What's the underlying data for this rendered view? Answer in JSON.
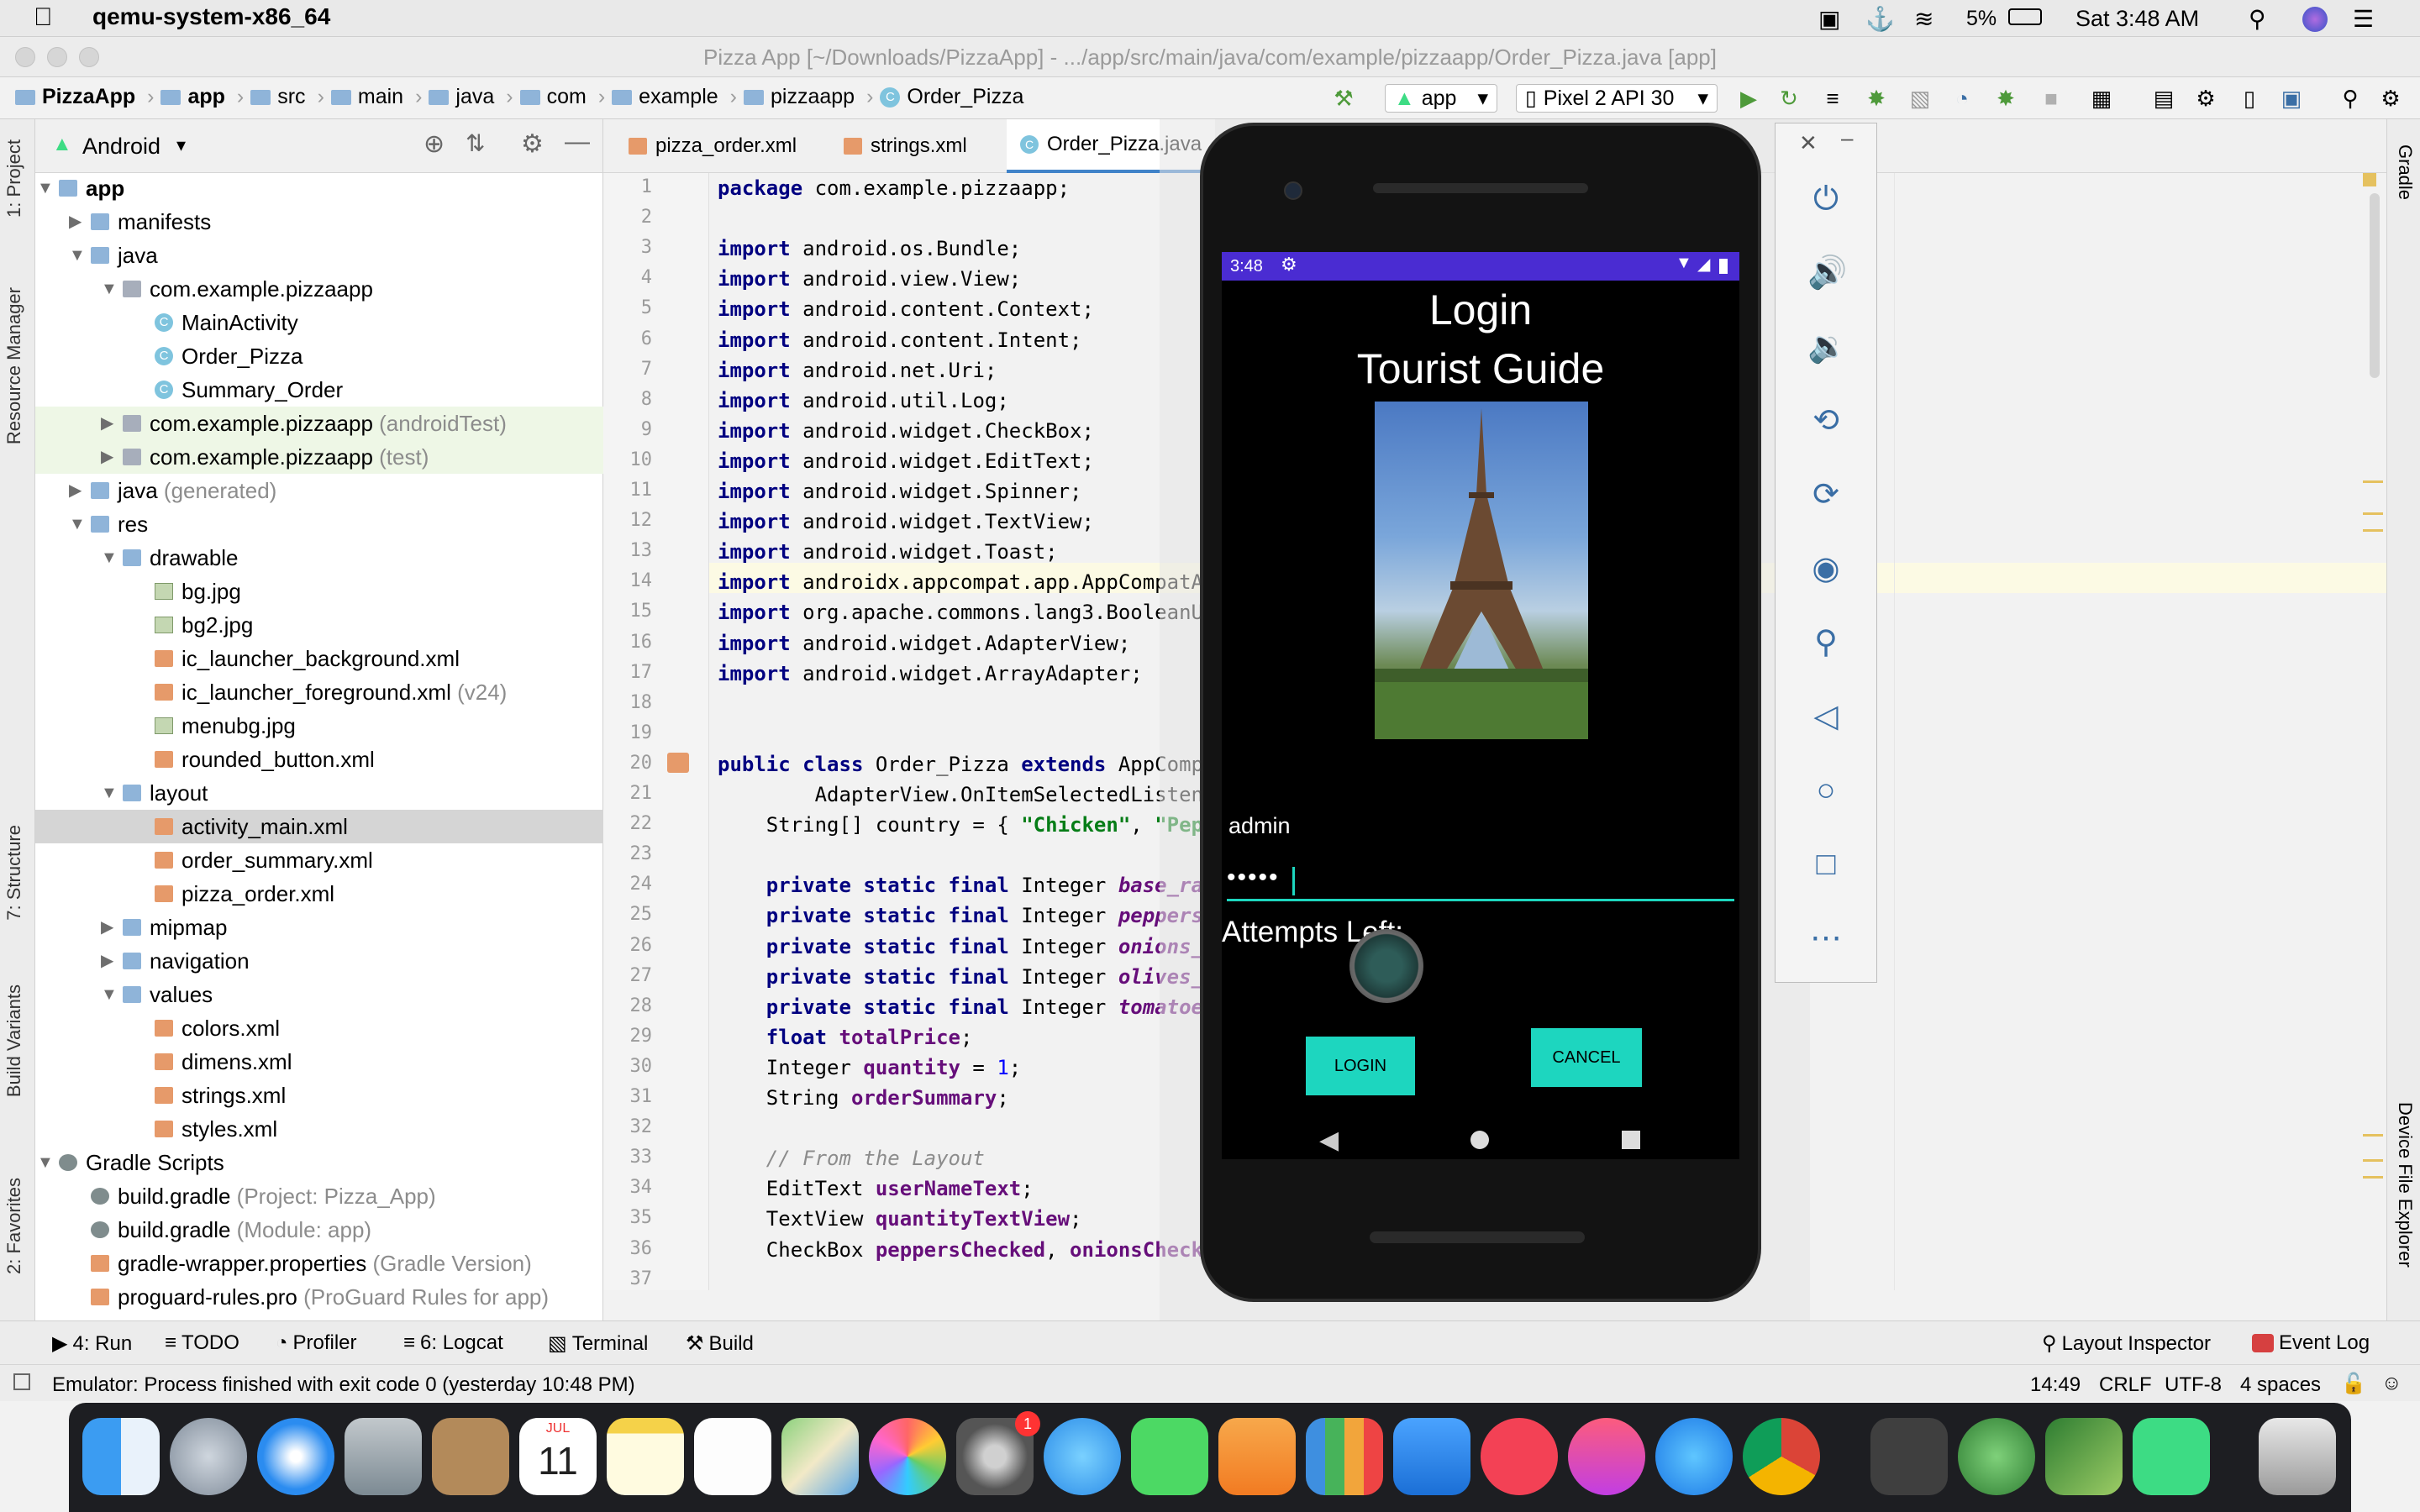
{
  "menubar": {
    "app_name": "qemu-system-x86_64",
    "battery": "5%",
    "clock": "Sat 3:48 AM"
  },
  "window": {
    "title": "Pizza App [~/Downloads/PizzaApp] - .../app/src/main/java/com/example/pizzaapp/Order_Pizza.java [app]"
  },
  "breadcrumb": [
    "PizzaApp",
    "app",
    "src",
    "main",
    "java",
    "com",
    "example",
    "pizzaapp",
    "Order_Pizza"
  ],
  "toolbar": {
    "run_config": "app",
    "device": "Pixel 2 API 30"
  },
  "left_stripe": {
    "project": "1: Project",
    "resource_manager": "Resource Manager",
    "structure": "7: Structure",
    "build_variants": "Build Variants",
    "favorites": "2: Favorites"
  },
  "right_stripe": {
    "gradle": "Gradle",
    "device_file_explorer": "Device File Explorer"
  },
  "project_panel": {
    "view": "Android",
    "tree": [
      {
        "label": "app",
        "suffix": "",
        "indent": 0,
        "type": "folder",
        "bold": true,
        "expanded": true
      },
      {
        "label": "manifests",
        "suffix": "",
        "indent": 1,
        "type": "folder",
        "expanded": false
      },
      {
        "label": "java",
        "suffix": "",
        "indent": 1,
        "type": "folder",
        "expanded": true
      },
      {
        "label": "com.example.pizzaapp",
        "suffix": "",
        "indent": 2,
        "type": "pkg",
        "expanded": true
      },
      {
        "label": "MainActivity",
        "suffix": "",
        "indent": 3,
        "type": "cls"
      },
      {
        "label": "Order_Pizza",
        "suffix": "",
        "indent": 3,
        "type": "cls"
      },
      {
        "label": "Summary_Order",
        "suffix": "",
        "indent": 3,
        "type": "cls"
      },
      {
        "label": "com.example.pizzaapp",
        "suffix": "(androidTest)",
        "indent": 2,
        "type": "pkg",
        "expanded": false,
        "tint": true
      },
      {
        "label": "com.example.pizzaapp",
        "suffix": "(test)",
        "indent": 2,
        "type": "pkg",
        "expanded": false,
        "tint": true
      },
      {
        "label": "java",
        "suffix": "(generated)",
        "indent": 1,
        "type": "folder",
        "expanded": false
      },
      {
        "label": "res",
        "suffix": "",
        "indent": 1,
        "type": "folder",
        "expanded": true
      },
      {
        "label": "drawable",
        "suffix": "",
        "indent": 2,
        "type": "folder",
        "expanded": true
      },
      {
        "label": "bg.jpg",
        "suffix": "",
        "indent": 3,
        "type": "img"
      },
      {
        "label": "bg2.jpg",
        "suffix": "",
        "indent": 3,
        "type": "img"
      },
      {
        "label": "ic_launcher_background.xml",
        "suffix": "",
        "indent": 3,
        "type": "xml"
      },
      {
        "label": "ic_launcher_foreground.xml",
        "suffix": "(v24)",
        "indent": 3,
        "type": "xml"
      },
      {
        "label": "menubg.jpg",
        "suffix": "",
        "indent": 3,
        "type": "img"
      },
      {
        "label": "rounded_button.xml",
        "suffix": "",
        "indent": 3,
        "type": "xml"
      },
      {
        "label": "layout",
        "suffix": "",
        "indent": 2,
        "type": "folder",
        "expanded": true
      },
      {
        "label": "activity_main.xml",
        "suffix": "",
        "indent": 3,
        "type": "xml",
        "selected": true
      },
      {
        "label": "order_summary.xml",
        "suffix": "",
        "indent": 3,
        "type": "xml"
      },
      {
        "label": "pizza_order.xml",
        "suffix": "",
        "indent": 3,
        "type": "xml"
      },
      {
        "label": "mipmap",
        "suffix": "",
        "indent": 2,
        "type": "folder",
        "expanded": false
      },
      {
        "label": "navigation",
        "suffix": "",
        "indent": 2,
        "type": "folder",
        "expanded": false
      },
      {
        "label": "values",
        "suffix": "",
        "indent": 2,
        "type": "folder",
        "expanded": true
      },
      {
        "label": "colors.xml",
        "suffix": "",
        "indent": 3,
        "type": "xml"
      },
      {
        "label": "dimens.xml",
        "suffix": "",
        "indent": 3,
        "type": "xml"
      },
      {
        "label": "strings.xml",
        "suffix": "",
        "indent": 3,
        "type": "xml"
      },
      {
        "label": "styles.xml",
        "suffix": "",
        "indent": 3,
        "type": "xml"
      },
      {
        "label": "Gradle Scripts",
        "suffix": "",
        "indent": 0,
        "type": "grd",
        "expanded": true
      },
      {
        "label": "build.gradle",
        "suffix": "(Project: Pizza_App)",
        "indent": 1,
        "type": "grd"
      },
      {
        "label": "build.gradle",
        "suffix": "(Module: app)",
        "indent": 1,
        "type": "grd"
      },
      {
        "label": "gradle-wrapper.properties",
        "suffix": "(Gradle Version)",
        "indent": 1,
        "type": "xml"
      },
      {
        "label": "proguard-rules.pro",
        "suffix": "(ProGuard Rules for app)",
        "indent": 1,
        "type": "xml"
      }
    ]
  },
  "editor_tabs": [
    {
      "label": "pizza_order.xml",
      "active": false
    },
    {
      "label": "strings.xml",
      "active": false
    },
    {
      "label": "Order_Pizza.java",
      "active": true
    }
  ],
  "code_lines": [
    [
      [
        "kw",
        "package"
      ],
      [
        "",
        "com.example.pizzaapp;"
      ]
    ],
    [],
    [
      [
        "kw",
        "import"
      ],
      [
        "",
        "android.os.Bundle;"
      ]
    ],
    [
      [
        "kw",
        "import"
      ],
      [
        "",
        "android.view.View;"
      ]
    ],
    [
      [
        "kw",
        "import"
      ],
      [
        "",
        "android.content.Context;"
      ]
    ],
    [
      [
        "kw",
        "import"
      ],
      [
        "",
        "android.content.Intent;"
      ]
    ],
    [
      [
        "kw",
        "import"
      ],
      [
        "",
        "android.net.Uri;"
      ]
    ],
    [
      [
        "kw",
        "import"
      ],
      [
        "",
        "android.util.Log;"
      ]
    ],
    [
      [
        "kw",
        "import"
      ],
      [
        "",
        "android.widget.CheckBox;"
      ]
    ],
    [
      [
        "kw",
        "import"
      ],
      [
        "",
        "android.widget.EditText;"
      ]
    ],
    [
      [
        "kw",
        "import"
      ],
      [
        "",
        "android.widget.Spinner;"
      ]
    ],
    [
      [
        "kw",
        "import"
      ],
      [
        "",
        "android.widget.TextView;"
      ]
    ],
    [
      [
        "kw",
        "import"
      ],
      [
        "",
        "android.widget.Toast;"
      ]
    ],
    [
      [
        "kw",
        "import"
      ],
      [
        "",
        "androidx.appcompat.app.AppCompatAc"
      ]
    ],
    [
      [
        "kw",
        "import"
      ],
      [
        "",
        "org.apache.commons.lang3.BooleanUt"
      ]
    ],
    [
      [
        "kw",
        "import"
      ],
      [
        "",
        "android.widget.AdapterView;"
      ]
    ],
    [
      [
        "kw",
        "import"
      ],
      [
        "",
        "android.widget.ArrayAdapter;"
      ]
    ],
    [],
    [],
    [
      [
        "kw",
        "public class"
      ],
      [
        "",
        "Order_Pizza"
      ],
      [
        "kw",
        "extends"
      ],
      [
        "",
        "AppCompa"
      ]
    ],
    [
      [
        "",
        "        AdapterView.OnItemSelectedListene"
      ]
    ],
    [
      [
        "",
        "    String[] country = { "
      ],
      [
        "st",
        "\"Chicken\""
      ],
      [
        "",
        ", "
      ],
      [
        "st",
        "\"Pepp"
      ]
    ],
    [],
    [
      [
        "",
        "    "
      ],
      [
        "kw",
        "private static final"
      ],
      [
        "",
        "Integer"
      ],
      [
        "it",
        "base_rat"
      ]
    ],
    [
      [
        "",
        "    "
      ],
      [
        "kw",
        "private static final"
      ],
      [
        "",
        "Integer"
      ],
      [
        "it",
        "peppers_"
      ]
    ],
    [
      [
        "",
        "    "
      ],
      [
        "kw",
        "private static final"
      ],
      [
        "",
        "Integer"
      ],
      [
        "it",
        "onions_r"
      ]
    ],
    [
      [
        "",
        "    "
      ],
      [
        "kw",
        "private static final"
      ],
      [
        "",
        "Integer"
      ],
      [
        "it",
        "olives_r"
      ]
    ],
    [
      [
        "",
        "    "
      ],
      [
        "kw",
        "private static final"
      ],
      [
        "",
        "Integer"
      ],
      [
        "it",
        "tomatoes"
      ]
    ],
    [
      [
        "",
        "    "
      ],
      [
        "kw",
        "float"
      ],
      [
        "fd",
        "totalPrice"
      ],
      [
        "",
        ";"
      ]
    ],
    [
      [
        "",
        "    Integer "
      ],
      [
        "fd",
        "quantity"
      ],
      [
        "",
        ""
      ],
      [
        "",
        ""
      ],
      [
        "",
        "= "
      ],
      [
        "num",
        "1"
      ],
      [
        "",
        ";"
      ]
    ],
    [
      [
        "",
        "    String "
      ],
      [
        "fd",
        "orderSummary"
      ],
      [
        "",
        ";"
      ]
    ],
    [],
    [
      [
        "cm",
        "    // From the Layout"
      ]
    ],
    [
      [
        "",
        "    EditText "
      ],
      [
        "fd",
        "userNameText"
      ],
      [
        "",
        ";"
      ]
    ],
    [
      [
        "",
        "    TextView "
      ],
      [
        "fd",
        "quantityTextView"
      ],
      [
        "",
        ";"
      ]
    ],
    [
      [
        "",
        "    CheckBox "
      ],
      [
        "fd",
        "peppersChecked"
      ],
      [
        "",
        ", "
      ],
      [
        "fd",
        "onionsChecke"
      ]
    ],
    []
  ],
  "emulator": {
    "status_time": "3:48",
    "title_line1": "Login",
    "title_line2": "Tourist Guide",
    "username_value": "admin",
    "password_value": "•••••",
    "attempts_label": "Attempts Left:",
    "login_button": "LOGIN",
    "cancel_button": "CANCEL",
    "accent": "#1dd6bf",
    "statusbar_color": "#4a2cd2"
  },
  "bottom_tools": [
    "4: Run",
    "TODO",
    "Profiler",
    "6: Logcat",
    "Terminal",
    "Build"
  ],
  "bottom_right_tools": [
    "Layout Inspector",
    "Event Log"
  ],
  "status": {
    "message": "Emulator: Process finished with exit code 0 (yesterday 10:48 PM)",
    "position": "14:49",
    "line_sep": "CRLF",
    "encoding": "UTF-8",
    "indent": "4 spaces"
  },
  "dock": {
    "calendar_month": "JUL",
    "calendar_day": "11",
    "settings_badge": "1"
  }
}
